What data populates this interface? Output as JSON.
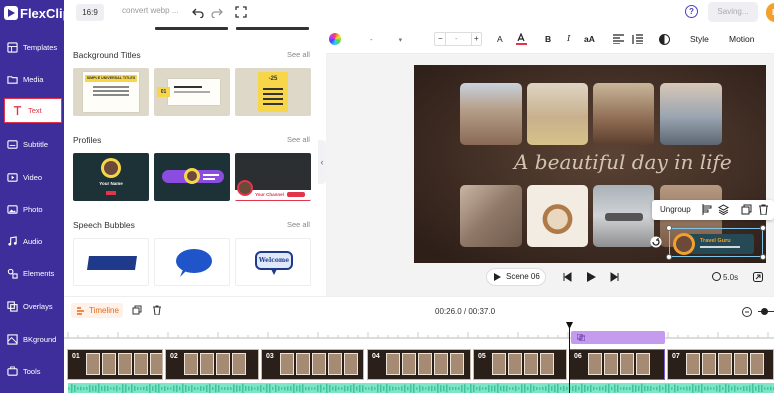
{
  "app": {
    "logo": "FlexClip"
  },
  "topbar": {
    "ratio": "16:9",
    "project_name": "convert webp ...",
    "saving": "Saving...",
    "export_initial": "E",
    "help": "?"
  },
  "sidebar": {
    "items": [
      {
        "label": "Templates",
        "icon": "templates-icon"
      },
      {
        "label": "Media",
        "icon": "media-icon"
      },
      {
        "label": "Text",
        "icon": "text-icon",
        "active": true
      },
      {
        "label": "Subtitle",
        "icon": "subtitle-icon"
      },
      {
        "label": "Video",
        "icon": "video-icon"
      },
      {
        "label": "Photo",
        "icon": "photo-icon"
      },
      {
        "label": "Audio",
        "icon": "audio-icon"
      },
      {
        "label": "Elements",
        "icon": "elements-icon"
      },
      {
        "label": "Overlays",
        "icon": "overlays-icon"
      },
      {
        "label": "BKground",
        "icon": "background-icon"
      },
      {
        "label": "Tools",
        "icon": "tools-icon"
      }
    ]
  },
  "panel": {
    "sections": [
      {
        "title": "Background Titles",
        "see_all": "See all"
      },
      {
        "title": "Profiles",
        "see_all": "See all"
      },
      {
        "title": "Speech Bubbles",
        "see_all": "See all"
      }
    ],
    "bg_titles": {
      "t1": "SIMPLE UNIVERSAL TITLES",
      "t2_num": "01",
      "t3_num": "-25"
    },
    "profiles": {
      "p1": "Your Name",
      "p3": "Your Channel"
    },
    "speech": {
      "s3": "Welcome"
    }
  },
  "styletoolbar": {
    "font": "-",
    "size": "-",
    "minus": "−",
    "plus": "+",
    "bold": "B",
    "italic": "I",
    "case": "aA",
    "style": "Style",
    "motion": "Motion"
  },
  "canvas": {
    "script_text": "A beautiful day in life",
    "badge_text": "Travel Guru"
  },
  "context_menu": {
    "ungroup": "Ungroup"
  },
  "player": {
    "scene": "Scene 06",
    "duration": "5.0s"
  },
  "timeline": {
    "label": "Timeline",
    "time": "00:26.0 / 00:37.0",
    "clips": [
      "01",
      "02",
      "03",
      "04",
      "05",
      "06",
      "07"
    ]
  },
  "colors": {
    "nav_bg": "#3d2e9c",
    "active": "#e0354b",
    "accent": "#4b3fc0",
    "export": "#f3a12c",
    "audio": "#7ee5c6",
    "overlay_track": "#c59bee"
  }
}
